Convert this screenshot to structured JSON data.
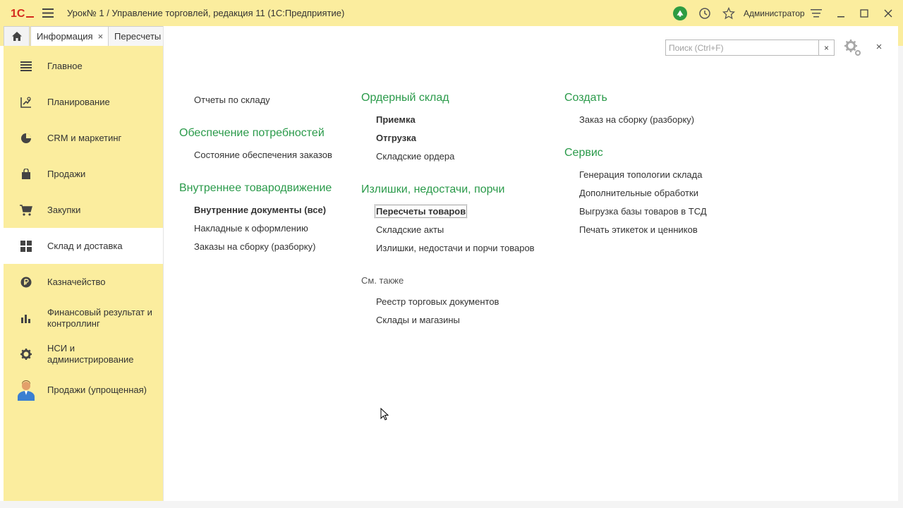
{
  "window": {
    "title": "Урок№ 1 / Управление торговлей, редакция 11  (1С:Предприятие)",
    "user": "Администратор",
    "icons": [
      "1c-logo",
      "menu-icon",
      "notifications-icon",
      "history-icon",
      "favorites-icon",
      "settings-lines-icon",
      "minimize-icon",
      "maximize-icon",
      "close-icon"
    ]
  },
  "tabs": [
    {
      "label": "Информация",
      "close": "×"
    },
    {
      "label": "Пересчеты"
    }
  ],
  "sidebar": {
    "items": [
      {
        "label": "Главное",
        "icon": "list-icon"
      },
      {
        "label": "Планирование",
        "icon": "planning-icon"
      },
      {
        "label": "CRM и маркетинг",
        "icon": "pie-chart-icon"
      },
      {
        "label": "Продажи",
        "icon": "bag-icon"
      },
      {
        "label": "Закупки",
        "icon": "cart-icon"
      },
      {
        "label": "Склад и доставка",
        "icon": "warehouse-icon"
      },
      {
        "label": "Казначейство",
        "icon": "ruble-icon"
      },
      {
        "label": "Финансовый результат и контроллинг",
        "icon": "bar-chart-icon"
      },
      {
        "label": "НСИ и администрирование",
        "icon": "gear-icon"
      },
      {
        "label": "Продажи (упрощенная)",
        "icon": "user-icon"
      }
    ],
    "active_index": 5
  },
  "search": {
    "placeholder": "Поиск (Ctrl+F)",
    "clear": "×"
  },
  "close_label": "×",
  "columns": {
    "col1": {
      "top_item": "Отчеты по складу",
      "groups": [
        {
          "title": "Обеспечение потребностей",
          "items": [
            "Состояние обеспечения заказов"
          ]
        },
        {
          "title": "Внутреннее товародвижение",
          "items": [
            "Внутренние документы (все)",
            "Накладные к оформлению",
            "Заказы на сборку (разборку)"
          ]
        }
      ]
    },
    "col2": {
      "groups": [
        {
          "title": "Ордерный склад",
          "items": [
            "Приемка",
            "Отгрузка",
            "Складские ордера"
          ]
        },
        {
          "title": "Излишки, недостачи, порчи",
          "items": [
            "Пересчеты товаров",
            "Складские акты",
            "Излишки, недостачи и порчи товаров"
          ]
        }
      ],
      "see_also": {
        "title": "См. также",
        "items": [
          "Реестр торговых документов",
          "Склады и магазины"
        ]
      }
    },
    "col3": {
      "groups": [
        {
          "title": "Создать",
          "items": [
            "Заказ на сборку (разборку)"
          ]
        },
        {
          "title": "Сервис",
          "items": [
            "Генерация топологии склада",
            "Дополнительные обработки",
            "Выгрузка базы товаров в ТСД",
            "Печать этикеток и ценников"
          ]
        }
      ]
    }
  },
  "colors": {
    "panel_yellow": "#fbed9e",
    "group_green": "#2a9a4a",
    "notify_green": "#2e9c42"
  }
}
